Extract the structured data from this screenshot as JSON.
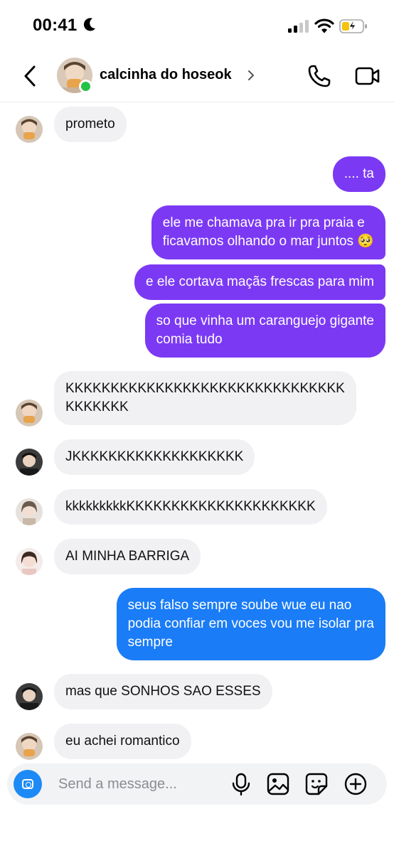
{
  "status": {
    "time": "00:41"
  },
  "header": {
    "contact_name": "calcinha do hoseok"
  },
  "messages": [
    {
      "text": "prometo"
    },
    {
      "text": ".... ta"
    },
    {
      "text": "ele me chamava pra ir pra praia e\nficavamos olhando o mar juntos 🥺"
    },
    {
      "text": "e ele cortava maçãs frescas para mim"
    },
    {
      "text": "so que vinha um caranguejo gigante\ncomia tudo"
    },
    {
      "text": "KKKKKKKKKKKKKKKKKKKKKKKKKKKKKKK\nKKKKKKK"
    },
    {
      "text": "JKKKKKKKKKKKKKKKKKKK"
    },
    {
      "text": "kkkkkkkkkKKKKKKKKKKKKKKKKKKKKK"
    },
    {
      "text": "AI MINHA BARRIGA"
    },
    {
      "text": "seus falso sempre soube wue eu nao\npodia confiar em voces vou me isolar pra\nsempre"
    },
    {
      "text": "mas que SONHOS SAO ESSES"
    },
    {
      "text": "eu achei romantico"
    }
  ],
  "composer": {
    "placeholder": "Send a message..."
  },
  "icons": {
    "status": [
      "moon-icon",
      "signal-icon",
      "wifi-icon",
      "battery-charging-icon"
    ],
    "header": [
      "back-arrow-icon",
      "chevron-right-icon",
      "phone-icon",
      "video-camera-icon"
    ],
    "composer": [
      "camera-icon",
      "microphone-icon",
      "image-icon",
      "sticker-icon",
      "plus-circle-icon"
    ]
  },
  "colors": {
    "outgoing_purple": "#7b39f4",
    "outgoing_blue": "#1a7cf6",
    "incoming": "#f1f1f4",
    "online": "#24c247",
    "camera_button": "#1d8af6"
  }
}
